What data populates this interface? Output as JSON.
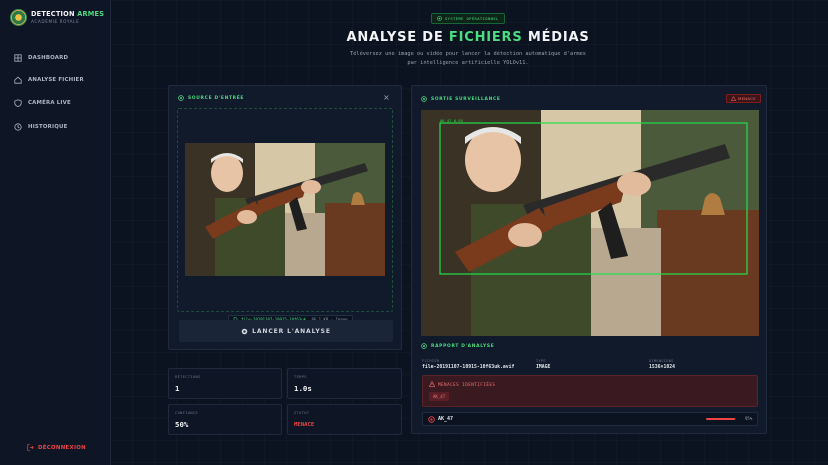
{
  "brand": {
    "title_main": "DETECTION",
    "title_accent": "ARMES",
    "subtitle": "ACADÉMIE ROYALE"
  },
  "sidebar": {
    "items": [
      {
        "label": "DASHBOARD",
        "icon": "dashboard-grid-icon"
      },
      {
        "label": "ANALYSE FICHIER",
        "icon": "home-icon"
      },
      {
        "label": "CAMÉRA LIVE",
        "icon": "shield-icon"
      },
      {
        "label": "HISTORIQUE",
        "icon": "clock-icon"
      }
    ],
    "logout_label": "DÉCONNEXION"
  },
  "header": {
    "status": "SYSTÈME OPÉRATIONNEL",
    "title_part1": "ANALYSE DE",
    "title_accent": "FICHIERS",
    "title_part2": "MÉDIAS",
    "subtitle_line1": "Téléversez une image ou vidéo pour lancer la détection automatique d'armes",
    "subtitle_line2": "par intelligence artificielle YOLOv11."
  },
  "source_panel": {
    "title": "SOURCE D'ENTRÉE",
    "close": "×",
    "file_name": "file-20191107-10915-10f63uk…",
    "file_meta": "86.1 KB · Image",
    "analyze_button": "LANCER L'ANALYSE"
  },
  "output_panel": {
    "title": "SORTIE SURVEILLANCE",
    "threat_tag": "MENACE",
    "box_label": "AK_47 0.95",
    "report_title": "RAPPORT D'ANALYSE",
    "report": {
      "file_label": "FICHIER",
      "file_value": "file-20191107-10915-10f63uk.avif",
      "type_label": "TYPE",
      "type_value": "IMAGE",
      "dims_label": "DIMENSIONS",
      "dims_value": "1536×1024"
    },
    "threats_title": "MENACES IDENTIFIÉES",
    "threats": [
      "AK_47"
    ],
    "detections": [
      {
        "name": "AK_47",
        "confidence": 95,
        "confidence_label": "95%"
      }
    ]
  },
  "stats": {
    "detections_label": "DÉTECTIONS",
    "detections_value": "1",
    "time_label": "TEMPS",
    "time_value": "1.0s",
    "confidence_label": "CONFIANCE",
    "confidence_value": "50%",
    "status_label": "STATUT",
    "status_value": "MENACE"
  },
  "colors": {
    "accent": "#4ade80",
    "danger": "#ef4444",
    "background": "#0b1220",
    "panel": "#111a2b"
  }
}
